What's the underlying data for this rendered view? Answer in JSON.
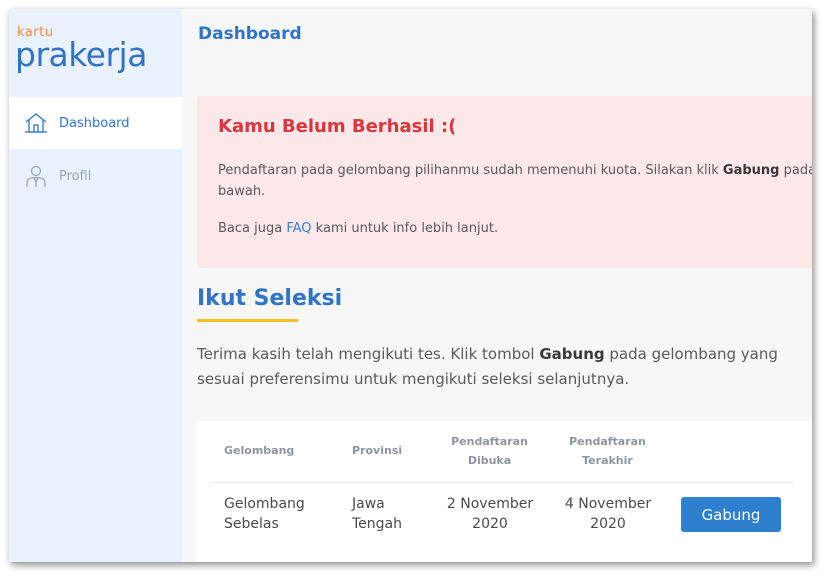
{
  "logo": {
    "small": "kartu",
    "big": "prakerja"
  },
  "sidebar": {
    "items": [
      {
        "label": "Dashboard",
        "icon": "home-icon",
        "active": true
      },
      {
        "label": "Profil",
        "icon": "user-icon",
        "active": false
      }
    ]
  },
  "header": {
    "title": "Dashboard"
  },
  "alert": {
    "title": "Kamu Belum Berhasil :(",
    "p1_before": "Pendaftaran pada gelombang pilihanmu sudah memenuhi kuota. Silakan klik ",
    "p1_bold": "Gabung",
    "p1_after": " pada g",
    "p1_line2": "bawah.",
    "p2_before": "Baca juga ",
    "p2_link": "FAQ",
    "p2_after": " kami untuk info lebih lanjut."
  },
  "section": {
    "title": "Ikut Seleksi",
    "intro_before": "Terima kasih telah mengikuti tes. Klik tombol ",
    "intro_bold": "Gabung",
    "intro_after": " pada gelombang yang sesuai preferensimu untuk mengikuti seleksi selanjutnya."
  },
  "table": {
    "headers": {
      "gelombang": "Gelombang",
      "provinsi": "Provinsi",
      "dibuka_1": "Pendaftaran",
      "dibuka_2": "Dibuka",
      "terakhir_1": "Pendaftaran",
      "terakhir_2": "Terakhir"
    },
    "rows": [
      {
        "gelombang_1": "Gelombang",
        "gelombang_2": "Sebelas",
        "provinsi_1": "Jawa",
        "provinsi_2": "Tengah",
        "dibuka_1": "2 November",
        "dibuka_2": "2020",
        "terakhir_1": "4 November",
        "terakhir_2": "2020",
        "action": "Gabung"
      }
    ]
  },
  "colors": {
    "primary": "#2f74c9",
    "alert_bg": "#fde8e9",
    "alert_title": "#d9363e",
    "underline": "#f4c21e",
    "sidebar_bg": "#e9f2fe",
    "logo_accent": "#f08a4b"
  }
}
